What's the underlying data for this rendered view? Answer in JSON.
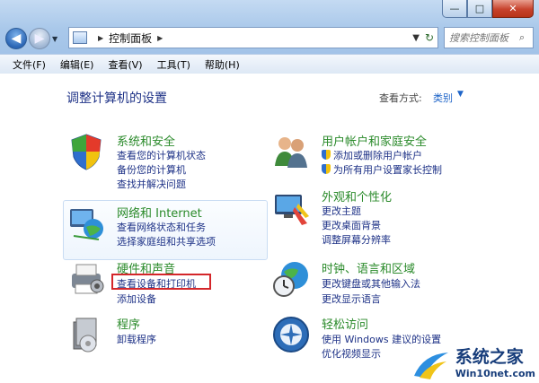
{
  "window": {
    "minimize": "—",
    "maximize": "□",
    "close": "✕"
  },
  "address": {
    "path": "控制面板",
    "search_placeholder": "搜索控制面板"
  },
  "menu": [
    "文件(F)",
    "编辑(E)",
    "查看(V)",
    "工具(T)",
    "帮助(H)"
  ],
  "main": {
    "title": "调整计算机的设置",
    "view_by_label": "查看方式:",
    "view_by_value": "类别"
  },
  "categories": {
    "system": {
      "title": "系统和安全",
      "links": [
        "查看您的计算机状态",
        "备份您的计算机",
        "查找并解决问题"
      ]
    },
    "network": {
      "title": "网络和 Internet",
      "links": [
        "查看网络状态和任务",
        "选择家庭组和共享选项"
      ]
    },
    "hardware": {
      "title": "硬件和声音",
      "links": [
        "查看设备和打印机",
        "添加设备"
      ]
    },
    "programs": {
      "title": "程序",
      "links": [
        "卸载程序"
      ]
    },
    "users": {
      "title": "用户帐户和家庭安全",
      "links": [
        "添加或删除用户帐户",
        "为所有用户设置家长控制"
      ]
    },
    "appearance": {
      "title": "外观和个性化",
      "links": [
        "更改主题",
        "更改桌面背景",
        "调整屏幕分辨率"
      ]
    },
    "clock": {
      "title": "时钟、语言和区域",
      "links": [
        "更改键盘或其他输入法",
        "更改显示语言"
      ]
    },
    "ease": {
      "title": "轻松访问",
      "links": [
        "使用 Windows 建议的设置",
        "优化视频显示"
      ]
    }
  },
  "watermark": {
    "brand": "系统之家",
    "url": "Win10net.com"
  },
  "colors": {
    "link": "#1e3287",
    "category_title": "#2a8a2a",
    "highlight_box": "#d4262a"
  }
}
